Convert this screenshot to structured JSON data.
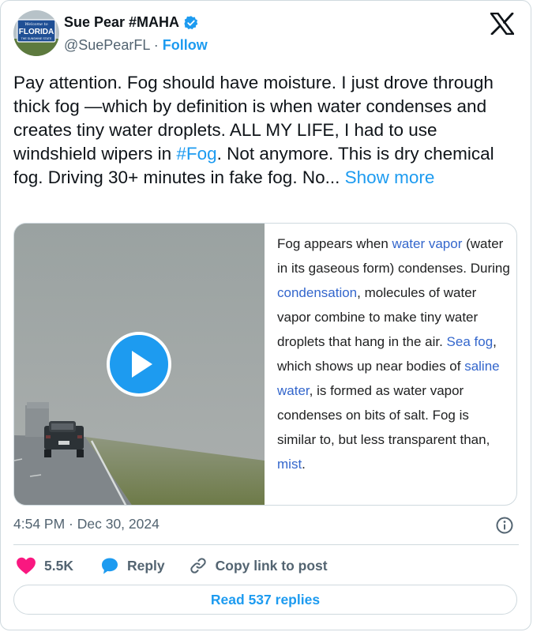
{
  "user": {
    "display_name": "Sue Pear #MAHA",
    "handle": "@SuePearFL",
    "separator": "·",
    "follow_label": "Follow",
    "verified": true,
    "avatar_icon": "florida-welcome-sign-avatar",
    "avatar_text": {
      "line1": "Welcome to",
      "line2": "FLORIDA",
      "line3": "THE SUNSHINE STATE"
    }
  },
  "brand": {
    "logo": "x-logo-icon"
  },
  "tweet": {
    "text_before": "Pay attention. Fog should have moisture. I just drove through thick fog —which by definition is when water condenses and creates tiny water droplets. ALL MY LIFE, I had to use windshield wipers in ",
    "hashtag": "#Fog",
    "text_after": ". Not anymore. This is dry chemical fog. Driving 30+ minutes in fake fog. No... ",
    "show_more": "Show more"
  },
  "media": {
    "video_description": "foggy highway with a pickup truck",
    "play_icon": "play-icon",
    "wiki_excerpt": {
      "p1": "Fog appears when ",
      "l1": "water vapor",
      "p2": " (water in its gaseous form) condenses. During ",
      "l2": "condensation",
      "p3": ", molecules of water vapor combine to make tiny water droplets that hang in the air. ",
      "l3": "Sea fog",
      "p4": ", which shows up near bodies of ",
      "l4": "saline water",
      "p5": ", is formed as water vapor condenses on bits of salt. Fog is similar to, but less transparent than, ",
      "l5": "mist",
      "p6": "."
    }
  },
  "meta": {
    "timestamp": "4:54 PM · Dec 30, 2024",
    "info_icon": "info-icon"
  },
  "actions": {
    "likes": "5.5K",
    "reply_label": "Reply",
    "copy_link_label": "Copy link to post"
  },
  "read_replies_label": "Read 537 replies",
  "colors": {
    "accent": "#1d9bf0",
    "like": "#f91880",
    "wiki_link": "#3366cc",
    "muted": "#536471"
  }
}
